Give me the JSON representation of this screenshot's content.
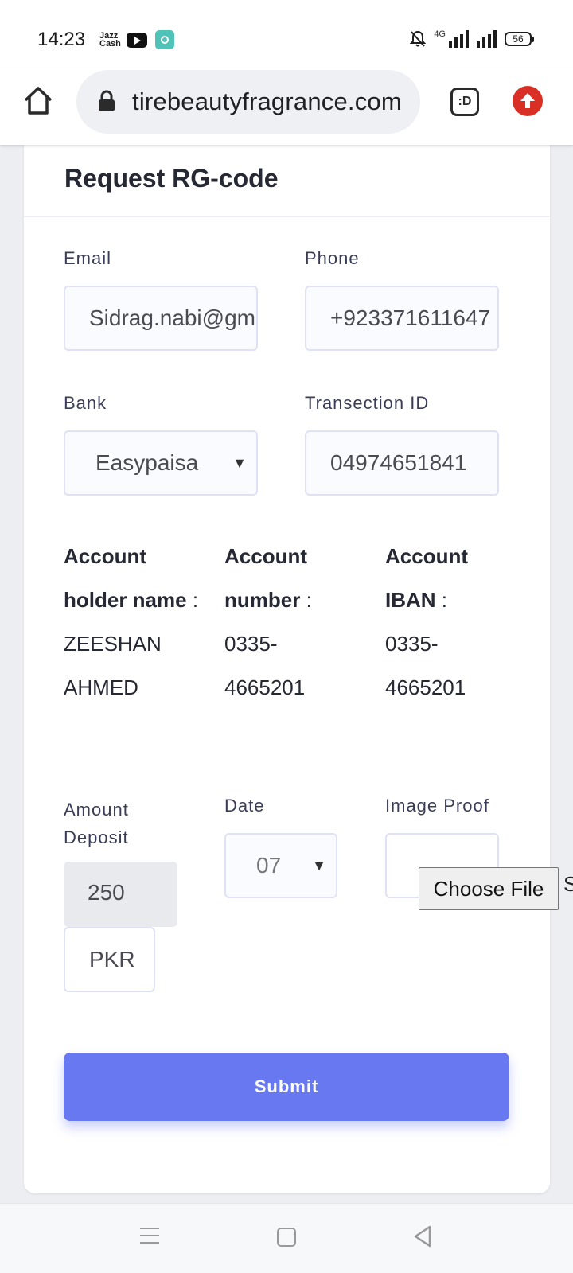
{
  "status_bar": {
    "time": "14:23",
    "app_icons": [
      "jazzcash-icon",
      "youtube-icon",
      "app-icon"
    ],
    "jazz_label": "Jazz Cash",
    "network": "4G",
    "battery": "56"
  },
  "browser": {
    "url": "tirebeautyfragrance.com",
    "tabs_label": ":D",
    "colors": {
      "extension": "#d93025"
    }
  },
  "form": {
    "title": "Request RG-code",
    "email": {
      "label": "Email",
      "value": "Sidrag.nabi@gmail.com"
    },
    "phone": {
      "label": "Phone",
      "value": "+923371611647"
    },
    "bank": {
      "label": "Bank",
      "value": "Easypaisa"
    },
    "transaction": {
      "label": "Transection ID",
      "value": "04974651841"
    },
    "account_holder": {
      "label": "Account holder name",
      "sep": ":",
      "value_1": "ZEESHAN",
      "value_2": "AHMED"
    },
    "account_number": {
      "label": "Account number",
      "sep": ":",
      "value_1": "0335-",
      "value_2": "4665201"
    },
    "account_iban": {
      "label": "Account IBAN",
      "sep": ":",
      "value_1": "0335-",
      "value_2": "4665201"
    },
    "amount": {
      "label_1": "Amount",
      "label_2": "Deposit",
      "value": "250",
      "currency": "PKR"
    },
    "date": {
      "label": "Date",
      "value": "07"
    },
    "image_proof": {
      "label": "Image Proof",
      "button": "Choose File",
      "overflow_text": "S"
    },
    "submit_label": "Submit",
    "colors": {
      "accent": "#6878f0",
      "field_border": "#dfe1f6"
    }
  }
}
